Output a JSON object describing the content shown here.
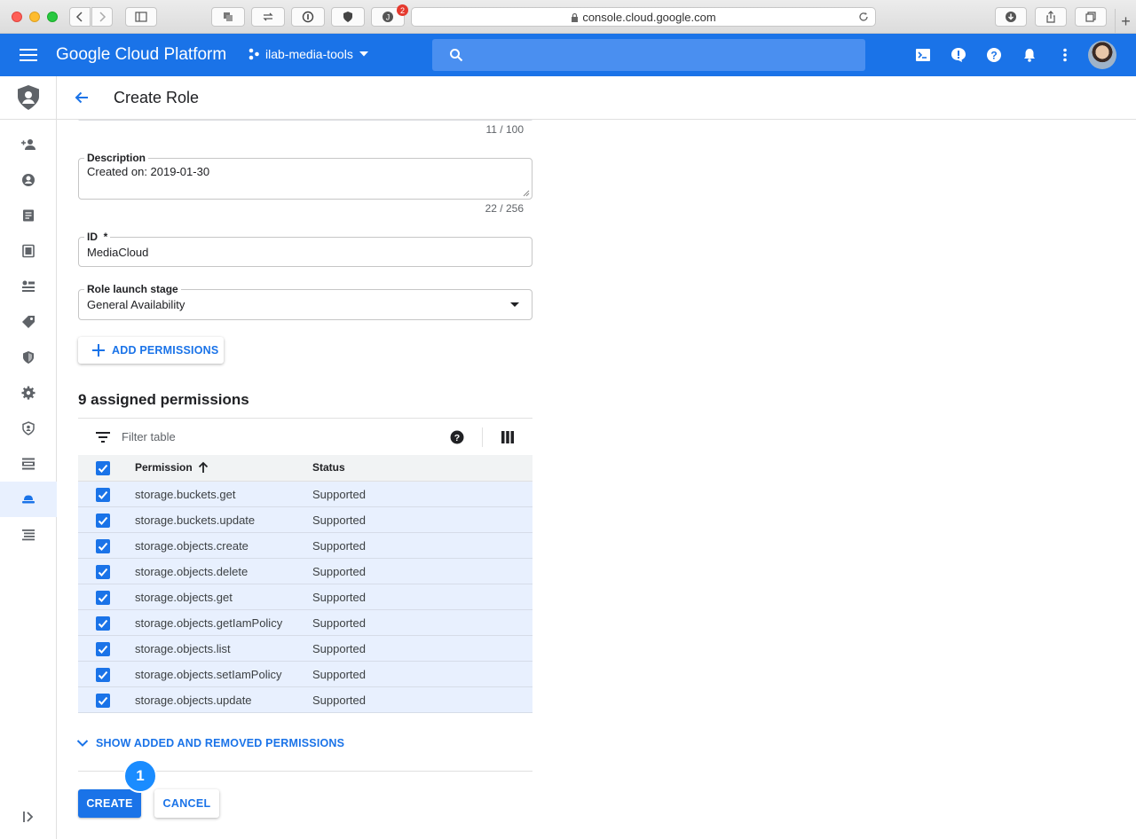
{
  "browser": {
    "url": "console.cloud.google.com",
    "extension_badge": "2",
    "new_tab": "+"
  },
  "header": {
    "product_name": "Google Cloud Platform",
    "project_name": "ilab-media-tools"
  },
  "page": {
    "title": "Create Role"
  },
  "form": {
    "title_counter": "11 / 100",
    "description": {
      "label": "Description",
      "value": "Created on: 2019-01-30",
      "counter": "22 / 256"
    },
    "id": {
      "label": "ID",
      "required_mark": "*",
      "value": "MediaCloud"
    },
    "launch_stage": {
      "label": "Role launch stage",
      "value": "General Availability"
    },
    "add_permissions_label": "ADD PERMISSIONS"
  },
  "permissions": {
    "heading": "9 assigned permissions",
    "filter_placeholder": "Filter table",
    "columns": {
      "permission": "Permission",
      "status": "Status"
    },
    "rows": [
      {
        "permission": "storage.buckets.get",
        "status": "Supported"
      },
      {
        "permission": "storage.buckets.update",
        "status": "Supported"
      },
      {
        "permission": "storage.objects.create",
        "status": "Supported"
      },
      {
        "permission": "storage.objects.delete",
        "status": "Supported"
      },
      {
        "permission": "storage.objects.get",
        "status": "Supported"
      },
      {
        "permission": "storage.objects.getIamPolicy",
        "status": "Supported"
      },
      {
        "permission": "storage.objects.list",
        "status": "Supported"
      },
      {
        "permission": "storage.objects.setIamPolicy",
        "status": "Supported"
      },
      {
        "permission": "storage.objects.update",
        "status": "Supported"
      }
    ],
    "show_added_removed_label": "SHOW ADDED AND REMOVED PERMISSIONS"
  },
  "actions": {
    "create_label": "CREATE",
    "cancel_label": "CANCEL",
    "step_badge": "1"
  },
  "colors": {
    "brand_blue": "#1a73e8",
    "selected_row": "#e8f0fe",
    "step_badge": "#1a8cff"
  }
}
